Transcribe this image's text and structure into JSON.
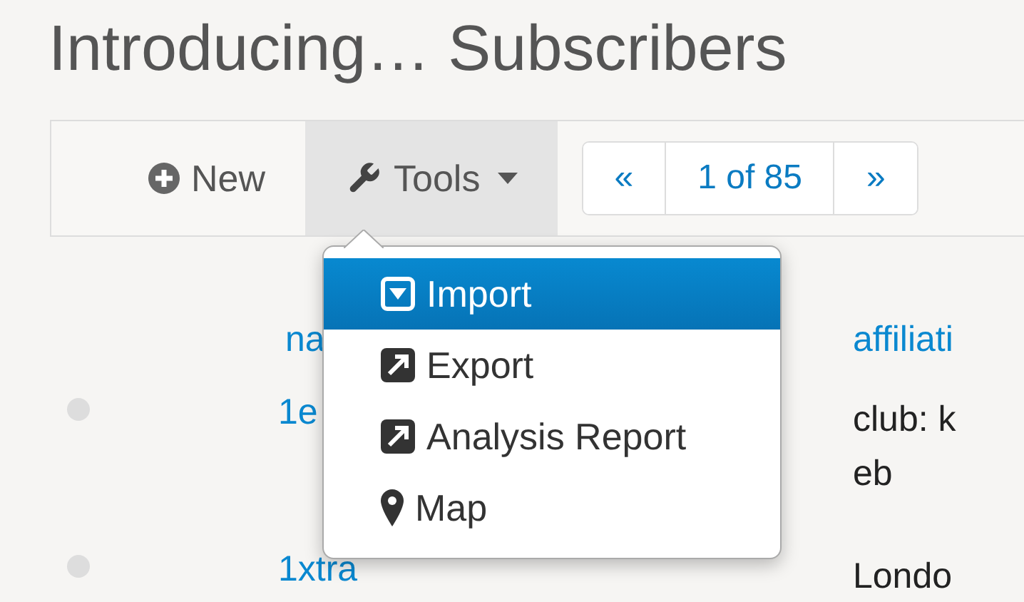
{
  "page_title": "Introducing… Subscribers",
  "toolbar": {
    "buttons": [
      {
        "label": "New",
        "kind": "new",
        "active": false
      },
      {
        "label": "Tools",
        "kind": "tools",
        "active": true
      }
    ],
    "pager": {
      "previous": "«",
      "position": "1 of 85",
      "next": "»"
    }
  },
  "tools_menu": {
    "expanded": true,
    "items": [
      {
        "label": "Import",
        "kind": "import",
        "selected": true
      },
      {
        "label": "Export",
        "kind": "export",
        "selected": false
      },
      {
        "label": "Analysis Report",
        "kind": "export",
        "selected": false
      },
      {
        "label": "Map",
        "kind": "map",
        "selected": false
      }
    ]
  },
  "table": {
    "columns": [
      "na",
      "affiliati"
    ],
    "rows": [
      {
        "name": "1e",
        "affiliation": [
          "club: k",
          "eb"
        ]
      },
      {
        "name": "1xtra",
        "affiliation": [
          "Londo"
        ]
      }
    ]
  }
}
